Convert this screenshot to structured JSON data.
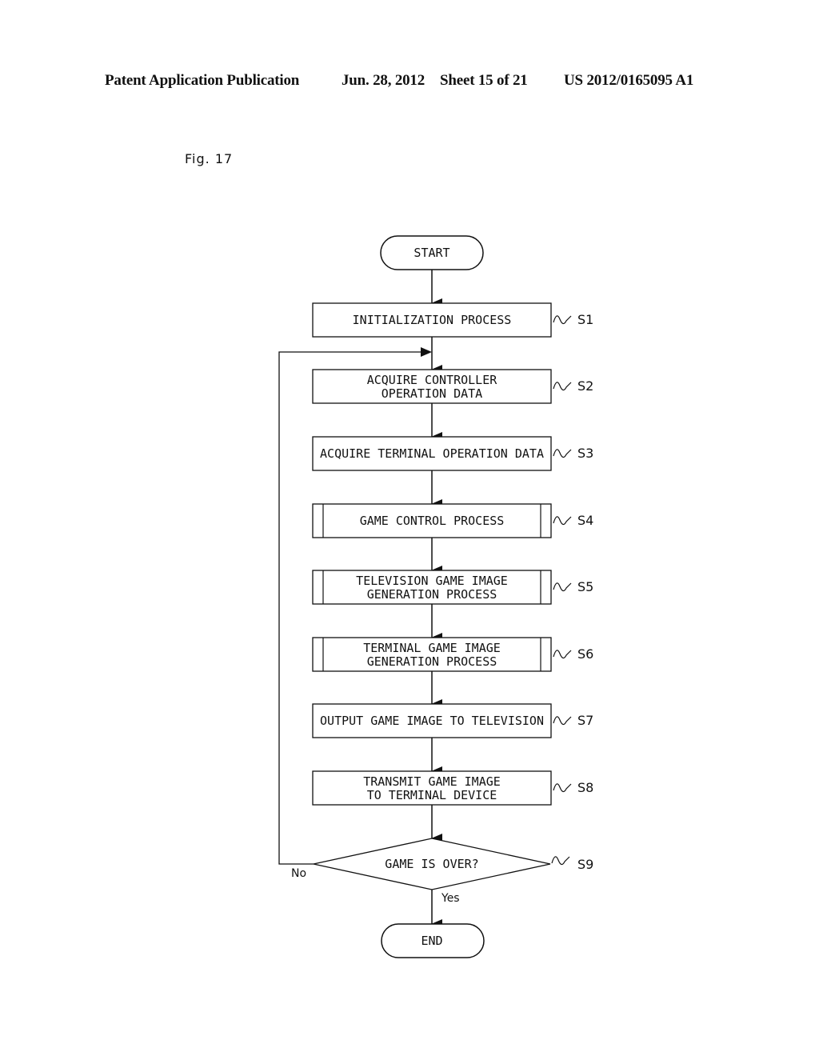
{
  "header": {
    "publication": "Patent Application Publication",
    "date": "Jun. 28, 2012",
    "sheet": "Sheet 15 of 21",
    "number": "US 2012/0165095 A1"
  },
  "figure": {
    "label": "Fig. 17"
  },
  "flowchart": {
    "start": "START",
    "end": "END",
    "steps": [
      {
        "id": "S1",
        "type": "process",
        "lines": [
          "INITIALIZATION PROCESS"
        ]
      },
      {
        "id": "S2",
        "type": "process",
        "lines": [
          "ACQUIRE CONTROLLER",
          "OPERATION DATA"
        ]
      },
      {
        "id": "S3",
        "type": "process",
        "lines": [
          "ACQUIRE TERMINAL OPERATION DATA"
        ]
      },
      {
        "id": "S4",
        "type": "subprocess",
        "lines": [
          "GAME CONTROL PROCESS"
        ]
      },
      {
        "id": "S5",
        "type": "subprocess",
        "lines": [
          "TELEVISION GAME IMAGE",
          "GENERATION PROCESS"
        ]
      },
      {
        "id": "S6",
        "type": "subprocess",
        "lines": [
          "TERMINAL GAME IMAGE",
          "GENERATION PROCESS"
        ]
      },
      {
        "id": "S7",
        "type": "process",
        "lines": [
          "OUTPUT GAME IMAGE TO TELEVISION"
        ]
      },
      {
        "id": "S8",
        "type": "process",
        "lines": [
          "TRANSMIT GAME IMAGE",
          "TO TERMINAL DEVICE"
        ]
      }
    ],
    "decision": {
      "id": "S9",
      "text": "GAME IS OVER?",
      "no_label": "No",
      "yes_label": "Yes"
    }
  }
}
